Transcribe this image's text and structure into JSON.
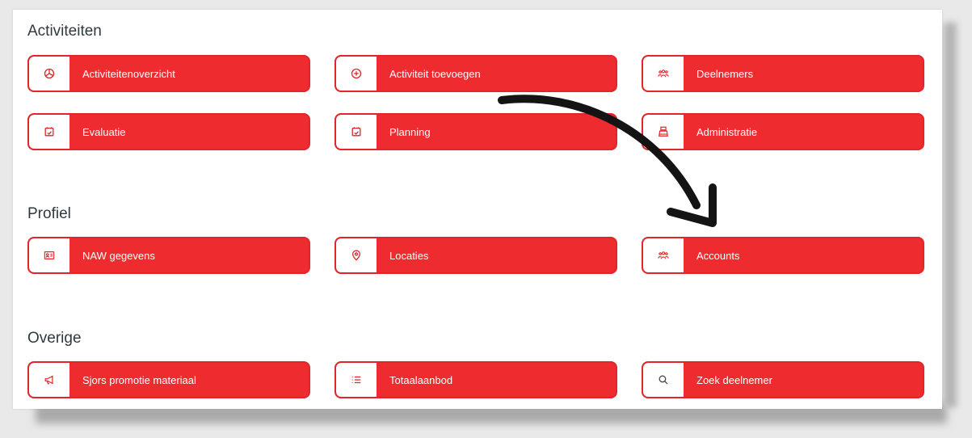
{
  "sections": [
    {
      "title": "Activiteiten",
      "items": [
        {
          "label": "Activiteitenoverzicht",
          "icon": "pie-chart-icon"
        },
        {
          "label": "Activiteit toevoegen",
          "icon": "plus-circle-icon"
        },
        {
          "label": "Deelnemers",
          "icon": "users-icon"
        },
        {
          "label": "Evaluatie",
          "icon": "calendar-check-icon"
        },
        {
          "label": "Planning",
          "icon": "calendar-check-icon"
        },
        {
          "label": "Administratie",
          "icon": "cash-register-icon"
        }
      ]
    },
    {
      "title": "Profiel",
      "items": [
        {
          "label": "NAW gegevens",
          "icon": "id-card-icon"
        },
        {
          "label": "Locaties",
          "icon": "location-pin-icon"
        },
        {
          "label": "Accounts",
          "icon": "users-icon"
        }
      ]
    },
    {
      "title": "Overige",
      "items": [
        {
          "label": "Sjors promotie materiaal",
          "icon": "megaphone-icon"
        },
        {
          "label": "Totaalaanbod",
          "icon": "list-icon"
        },
        {
          "label": "Zoek deelnemer",
          "icon": "search-icon"
        }
      ]
    }
  ],
  "colors": {
    "accent": "#ee2b2f",
    "icon": "#e0262a",
    "heading": "#2e3a3f",
    "arrow": "#141414"
  },
  "annotation": {
    "type": "curved-arrow",
    "from": "Activiteit toevoegen",
    "to": "Accounts"
  }
}
